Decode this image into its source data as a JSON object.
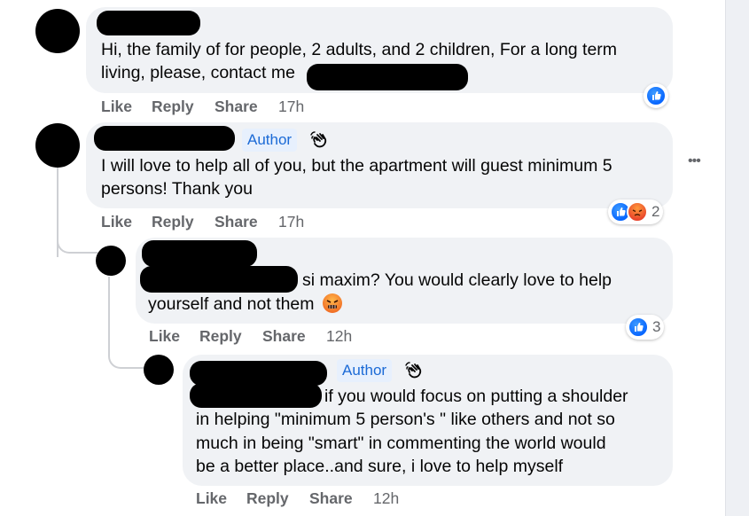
{
  "comments": [
    {
      "lines": [
        "Hi, the family of for people, 2 adults, and 2 children, For a long term",
        "living, please, contact me"
      ],
      "actions": {
        "like": "Like",
        "reply": "Reply",
        "share": "Share",
        "time": "17h"
      }
    },
    {
      "author_badge": "Author",
      "lines": [
        "I will love to help all of you, but the apartment will guest minimum 5",
        "persons! Thank you"
      ],
      "actions": {
        "like": "Like",
        "reply": "Reply",
        "share": "Share",
        "time": "17h"
      },
      "reaction_count": "2"
    },
    {
      "lines": [
        "si maxim? You would clearly love to help",
        "yourself and not them"
      ],
      "actions": {
        "like": "Like",
        "reply": "Reply",
        "share": "Share",
        "time": "12h"
      },
      "reaction_count": "3"
    },
    {
      "author_badge": "Author",
      "lines": [
        "if you would focus on putting a shoulder",
        "in helping \"minimum 5 person's \" like others and not so",
        "much in being \"smart\" in commenting the world would",
        "be a better place..and sure, i love to help myself"
      ],
      "actions": {
        "like": "Like",
        "reply": "Reply",
        "share": "Share",
        "time": "12h"
      }
    }
  ],
  "menu": {
    "dots": "•••"
  },
  "colors": {
    "accent": "#0866ff",
    "bubble": "#f0f2f5",
    "muted": "#65676b",
    "author_badge_bg": "#e7f0fd",
    "author_badge_text": "#1b6ad6"
  }
}
